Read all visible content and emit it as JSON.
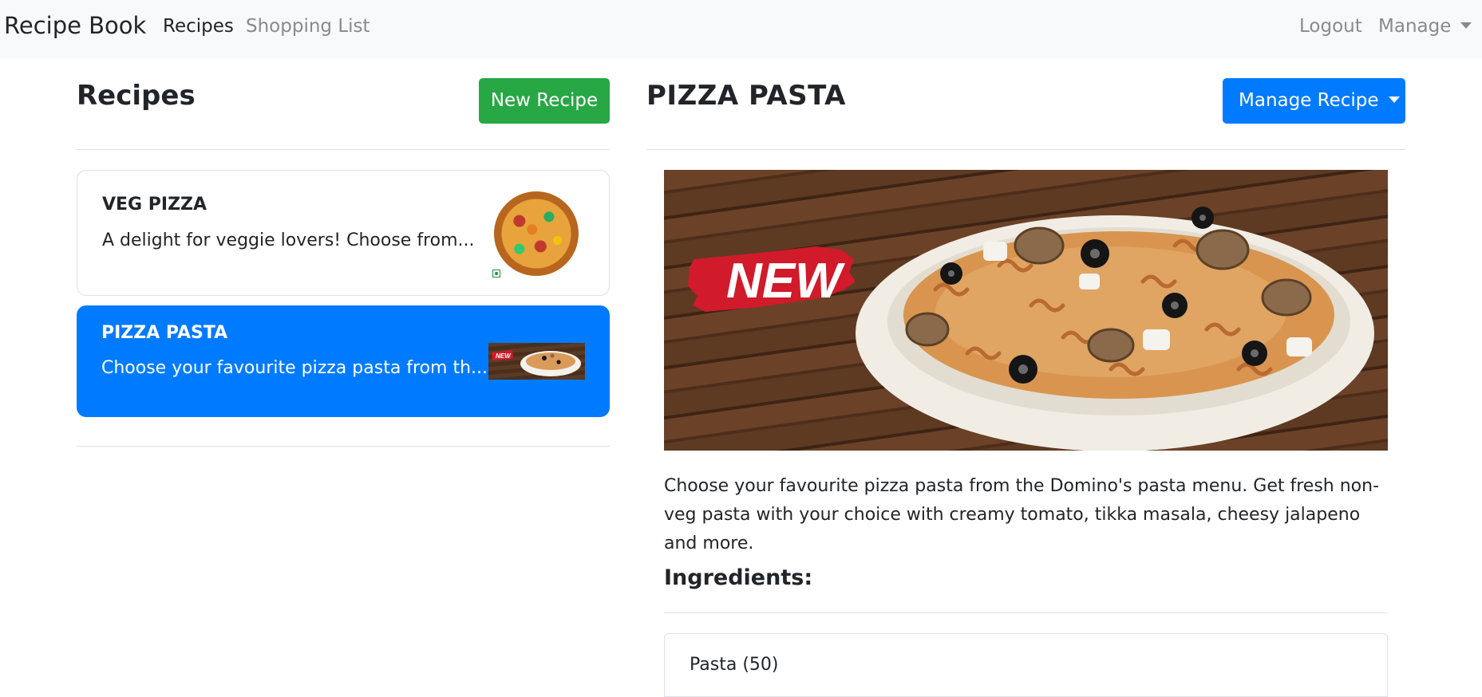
{
  "navbar": {
    "brand": "Recipe Book",
    "links": [
      {
        "label": "Recipes",
        "active": true
      },
      {
        "label": "Shopping List",
        "active": false
      }
    ],
    "right": {
      "logout": "Logout",
      "manage": "Manage"
    }
  },
  "recipe_list": {
    "title": "Recipes",
    "new_button": "New Recipe",
    "items": [
      {
        "name": "VEG PIZZA",
        "description": "A delight for veggie lovers! Choose from...",
        "selected": false,
        "image_icon": "veg-pizza-image"
      },
      {
        "name": "PIZZA PASTA",
        "description": "Choose your favourite pizza pasta from th...",
        "selected": true,
        "image_icon": "pizza-pasta-image"
      }
    ]
  },
  "detail": {
    "title": "PIZZA PASTA",
    "manage_button": "Manage Recipe",
    "hero_badge": "NEW",
    "description": "Choose your favourite pizza pasta from the Domino's pasta menu. Get fresh non-veg pasta with your choice with creamy tomato, tikka masala, cheesy jalapeno and more.",
    "ingredients_title": "Ingredients:",
    "ingredients": [
      {
        "label": "Pasta (50)"
      }
    ]
  },
  "colors": {
    "primary": "#007bff",
    "success": "#28a745",
    "navbar_bg": "#f8f9fa",
    "text": "#212529",
    "muted": "#8a8a8a",
    "border": "#dee2e6"
  }
}
